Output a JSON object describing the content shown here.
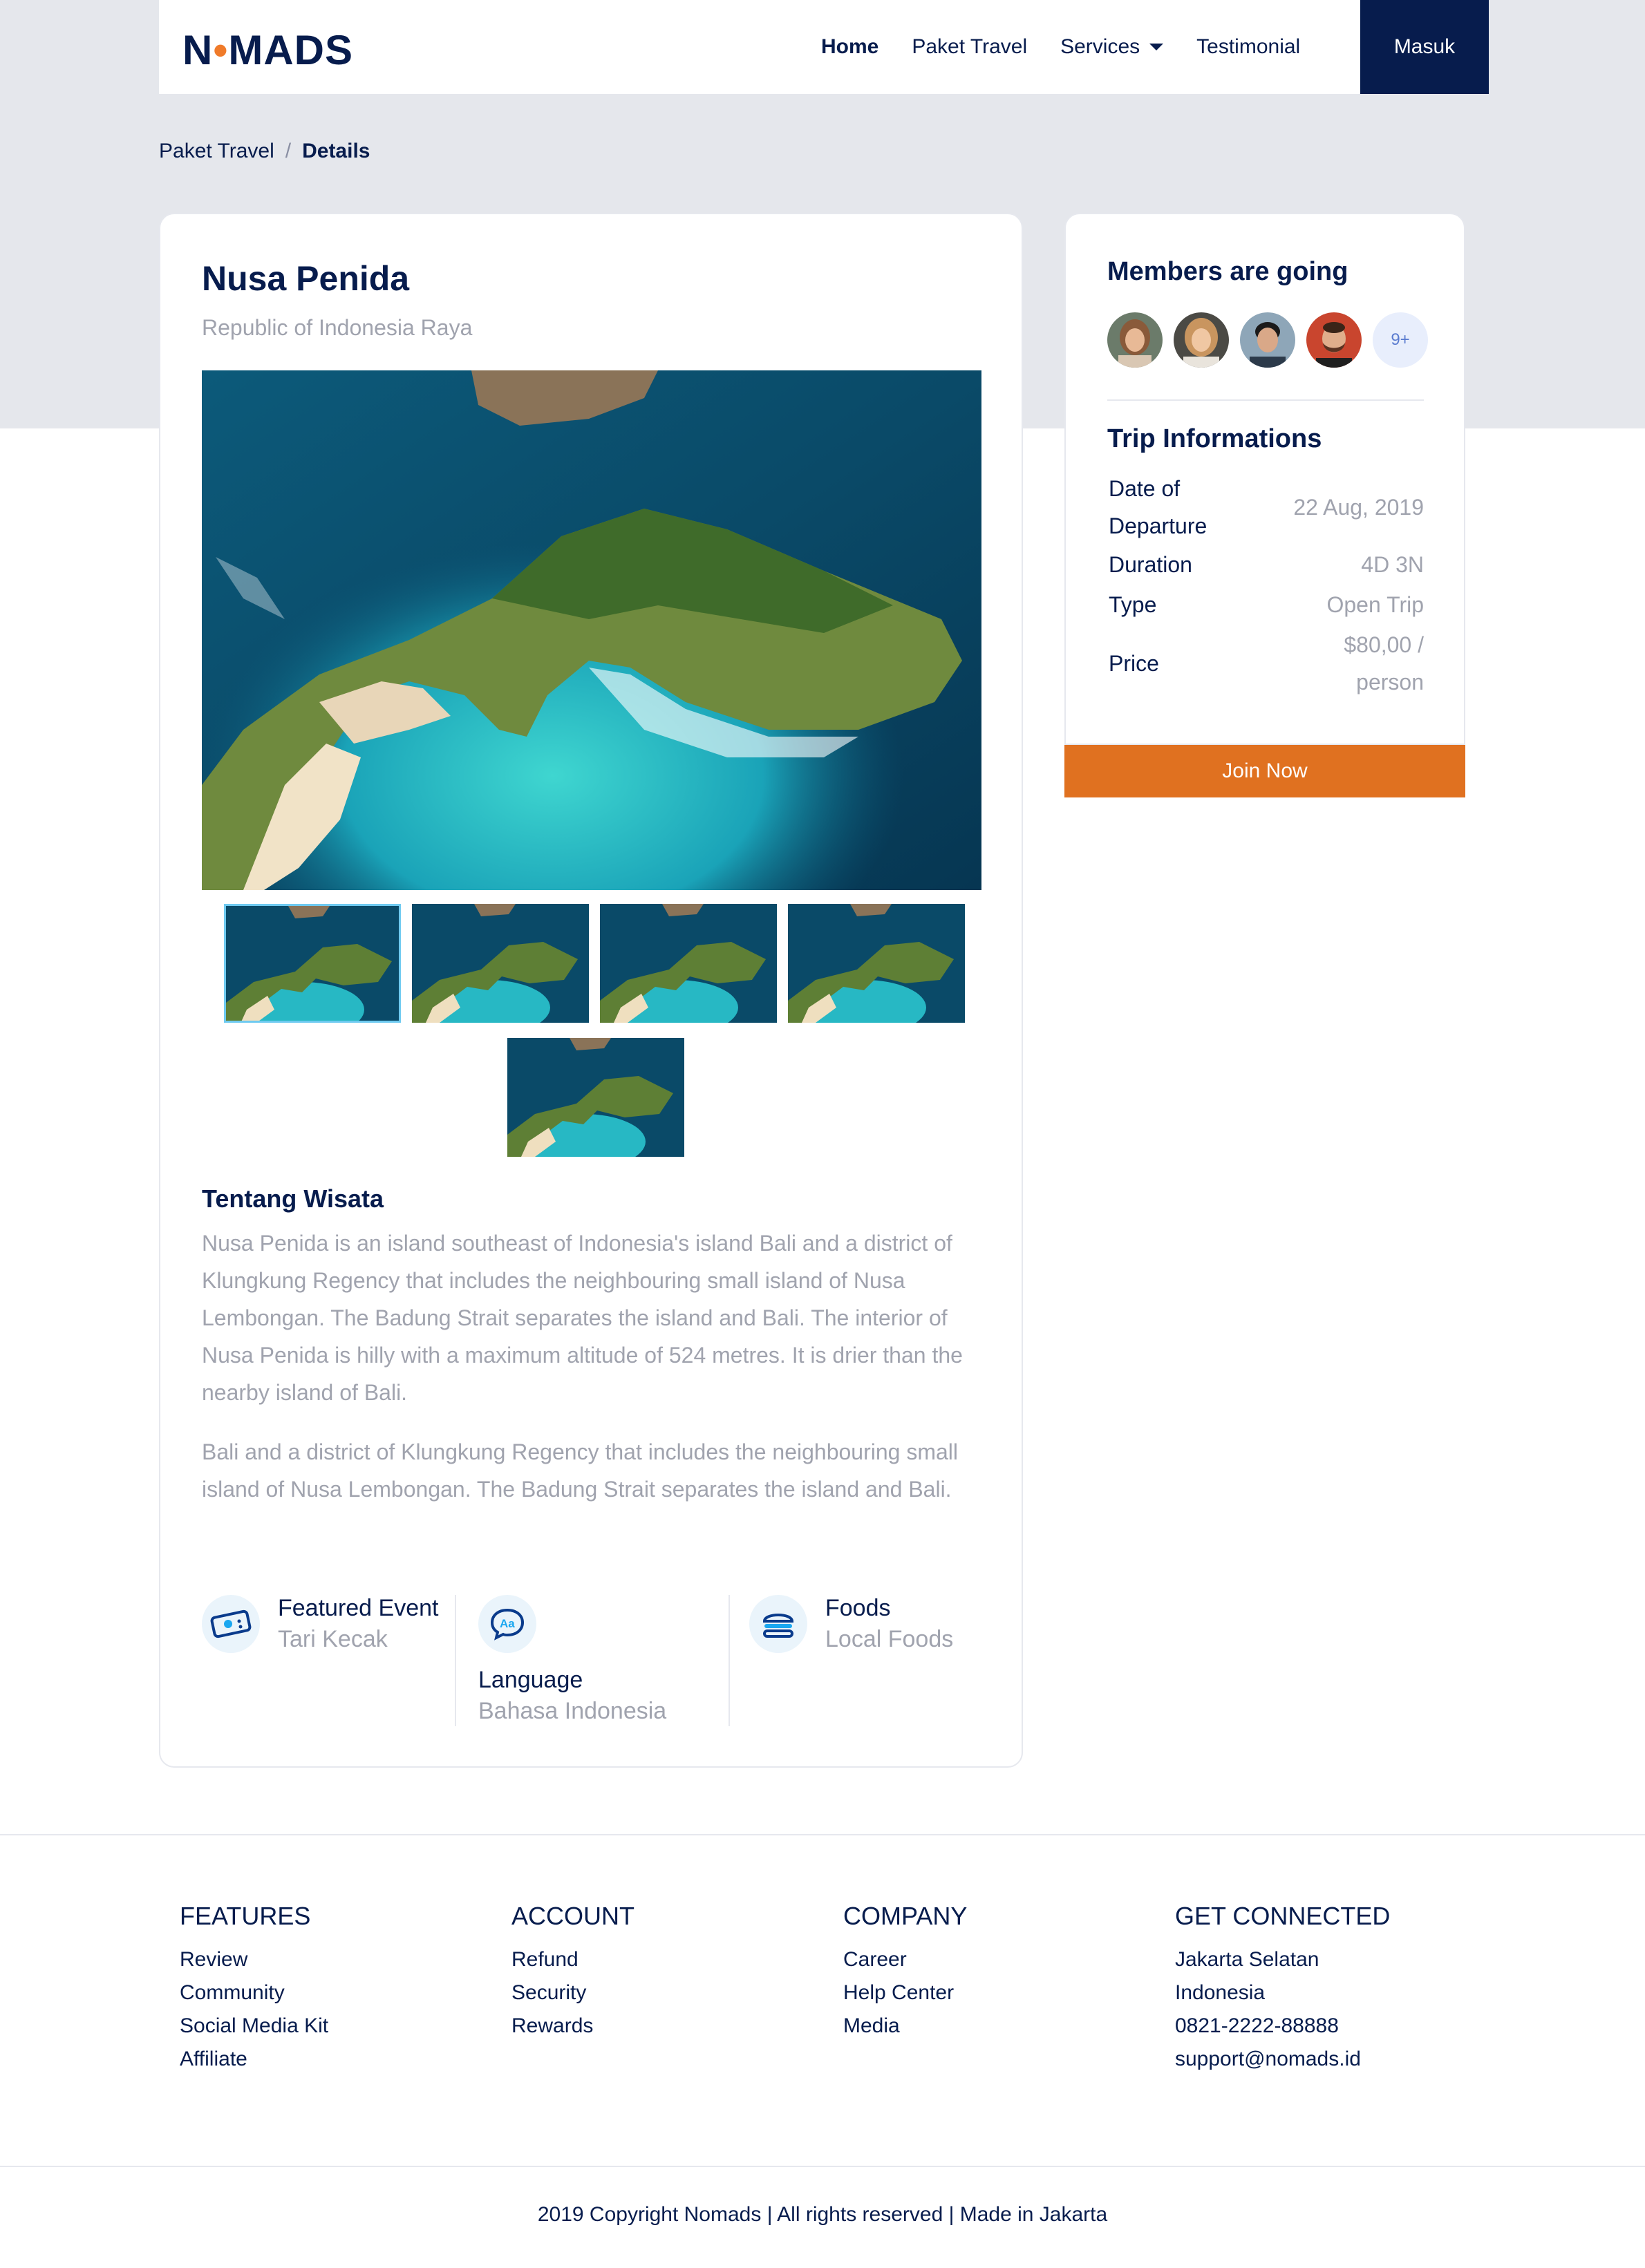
{
  "navbar": {
    "brand_prefix": "N",
    "brand_dot": "•",
    "brand_suffix": "MADS",
    "links": [
      "Home",
      "Paket Travel",
      "Services",
      "Testimonial"
    ],
    "login_label": "Masuk",
    "accent": "#071c4d"
  },
  "breadcrumb": {
    "parent": "Paket Travel",
    "separator": "/",
    "current": "Details"
  },
  "detail": {
    "title": "Nusa Penida",
    "subtitle": "Republic of Indonesia Raya",
    "about_title": "Tentang Wisata",
    "about_p1": "Nusa Penida is an island southeast of Indonesia's island Bali and a district of Klungkung Regency that includes the neighbouring small island of Nusa Lembongan. The Badung Strait separates the island and Bali. The interior of Nusa Penida is hilly with a maximum altitude of 524 metres. It is drier than the nearby island of Bali.",
    "about_p2": "Bali and a district of Klungkung Regency that includes the neighbouring small island of Nusa Lembongan. The Badung Strait separates the island and Bali.",
    "features": [
      {
        "icon": "ticket-icon",
        "label": "Featured Event",
        "value": "Tari Kecak"
      },
      {
        "icon": "language-icon",
        "label": "Language",
        "value": "Bahasa Indonesia"
      },
      {
        "icon": "burger-icon",
        "label": "Foods",
        "value": "Local Foods"
      }
    ]
  },
  "sidebar": {
    "members_title": "Members are going",
    "members_more": "9+",
    "trip_title": "Trip Informations",
    "rows": [
      {
        "label": "Date of Departure",
        "value": "22 Aug, 2019"
      },
      {
        "label": "Duration",
        "value": "4D 3N"
      },
      {
        "label": "Type",
        "value": "Open Trip"
      },
      {
        "label": "Price",
        "value": "$80,00 / person"
      }
    ],
    "join_label": "Join Now",
    "join_color": "#e07120"
  },
  "footer": {
    "columns": [
      {
        "title": "FEATURES",
        "links": [
          "Review",
          "Community",
          "Social Media Kit",
          "Affiliate"
        ]
      },
      {
        "title": "ACCOUNT",
        "links": [
          "Refund",
          "Security",
          "Rewards"
        ]
      },
      {
        "title": "COMPANY",
        "links": [
          "Career",
          "Help Center",
          "Media"
        ]
      },
      {
        "title": "GET CONNECTED",
        "links": [
          "Jakarta Selatan",
          "Indonesia",
          "0821-2222-88888",
          "support@nomads.id"
        ]
      }
    ],
    "copyright": "2019 Copyright Nomads | All rights reserved | Made in Jakarta"
  }
}
